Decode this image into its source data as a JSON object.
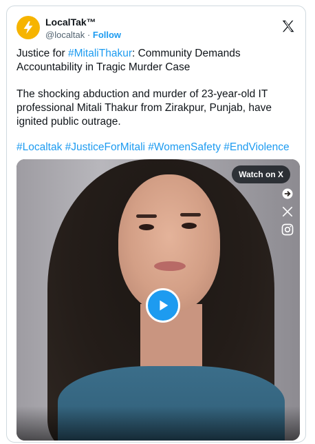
{
  "account": {
    "display_name": "LocalTak™",
    "handle": "@localtak",
    "separator": "·",
    "follow_label": "Follow",
    "avatar_icon": "lightning-logo-icon",
    "brand_color": "#f6b400"
  },
  "header": {
    "close_icon": "x-logo-icon"
  },
  "tweet": {
    "line1_prefix": "Justice for ",
    "line1_hashtag": "#MitaliThakur",
    "line1_suffix": ": Community Demands",
    "line2": "Accountability in Tragic Murder Case",
    "para2_line1": "The shocking abduction and murder of 23-year-old IT",
    "para2_line2": "professional Mitali Thakur from Zirakpur, Punjab, have",
    "para2_line3": "ignited public outrage.",
    "hashtags": [
      "#Localtak",
      "#JusticeForMitali",
      "#WomenSafety",
      "#EndViolence"
    ]
  },
  "media": {
    "watch_label": "Watch on X",
    "play_icon": "play-icon",
    "side_icons": [
      "share-icon",
      "x-logo-icon",
      "instagram-icon"
    ],
    "accent_color": "#1d9bf0"
  }
}
